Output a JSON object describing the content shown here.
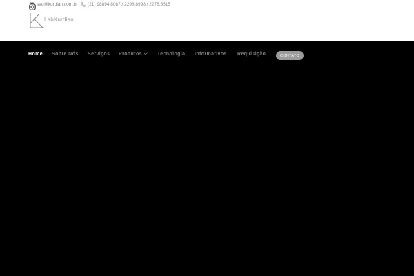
{
  "topbar": {
    "email": {
      "icon": "envelope-icon",
      "text": "sac@kurdian.com.br"
    },
    "phone": {
      "icon": "phone-icon",
      "text": "(21) 98894.8087 / 2298.8998 / 2278.5515"
    },
    "social": {
      "icon": "instagram-icon"
    }
  },
  "header": {
    "logo_icon": "labkurdian-logo-icon",
    "brand": "LabKurdian"
  },
  "nav": {
    "items": [
      {
        "label": "Home",
        "active": true
      },
      {
        "label": "Sobre Nós"
      },
      {
        "label": "Serviços"
      },
      {
        "label": "Produtos",
        "has_dropdown": true
      },
      {
        "label": "Tecnologia"
      },
      {
        "label": "Informativos"
      },
      {
        "label": "Requisição"
      }
    ],
    "cta": "CONTATO"
  },
  "colors": {
    "nav_background": "#000000",
    "nav_text": "#7c7c7c",
    "nav_active": "#ffffff",
    "cta_background": "#9b9b9b",
    "top_text": "#8a8a8a"
  }
}
